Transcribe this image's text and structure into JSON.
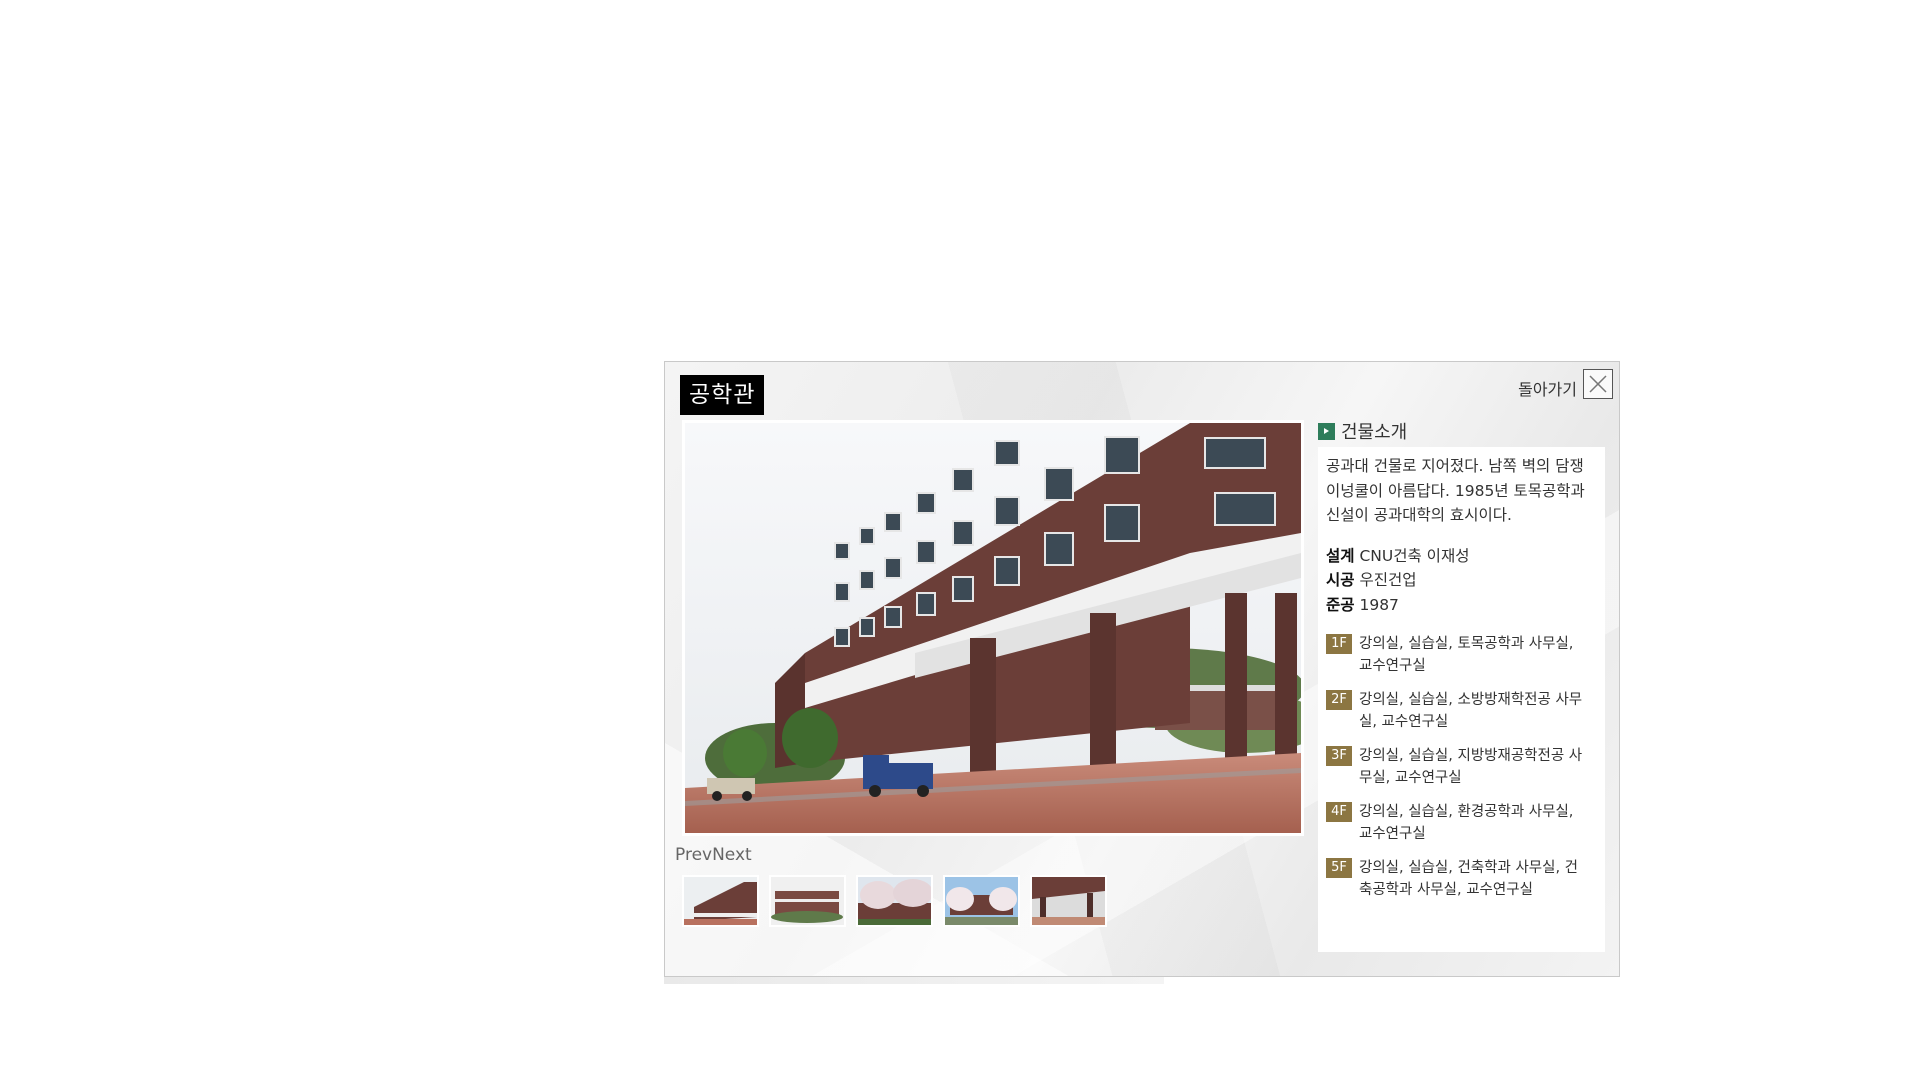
{
  "popup": {
    "title": "공학관",
    "back_label": "돌아가기",
    "close_icon": "close-icon"
  },
  "gallery": {
    "prev_label": "Prev",
    "next_label": "Next",
    "thumb_count": 5
  },
  "info": {
    "section_title": "건물소개",
    "description": "공과대 건물로 지어졌다. 남쪽 벽의 담쟁이넝쿨이 아름답다. 1985년 토목공학과 신설이 공과대학의 효시이다.",
    "meta": [
      {
        "label": "설계",
        "value": "CNU건축 이재성"
      },
      {
        "label": "시공",
        "value": "우진건업"
      },
      {
        "label": "준공",
        "value": "1987"
      }
    ],
    "floors": [
      {
        "floor": "1F",
        "text": "강의실, 실습실, 토목공학과 사무실, 교수연구실"
      },
      {
        "floor": "2F",
        "text": "강의실, 실습실, 소방방재학전공 사무실, 교수연구실"
      },
      {
        "floor": "3F",
        "text": "강의실, 실습실, 지방방재공학전공 사무실, 교수연구실"
      },
      {
        "floor": "4F",
        "text": "강의실, 실습실, 환경공학과 사무실, 교수연구실"
      },
      {
        "floor": "5F",
        "text": "강의실, 실습실, 건축학과 사무실, 건축공학과 사무실, 교수연구실"
      }
    ]
  },
  "colors": {
    "title_bg": "#000000",
    "section_icon": "#2e7d5b",
    "floor_tag": "#8c7642",
    "brick": "#6b3e38"
  }
}
